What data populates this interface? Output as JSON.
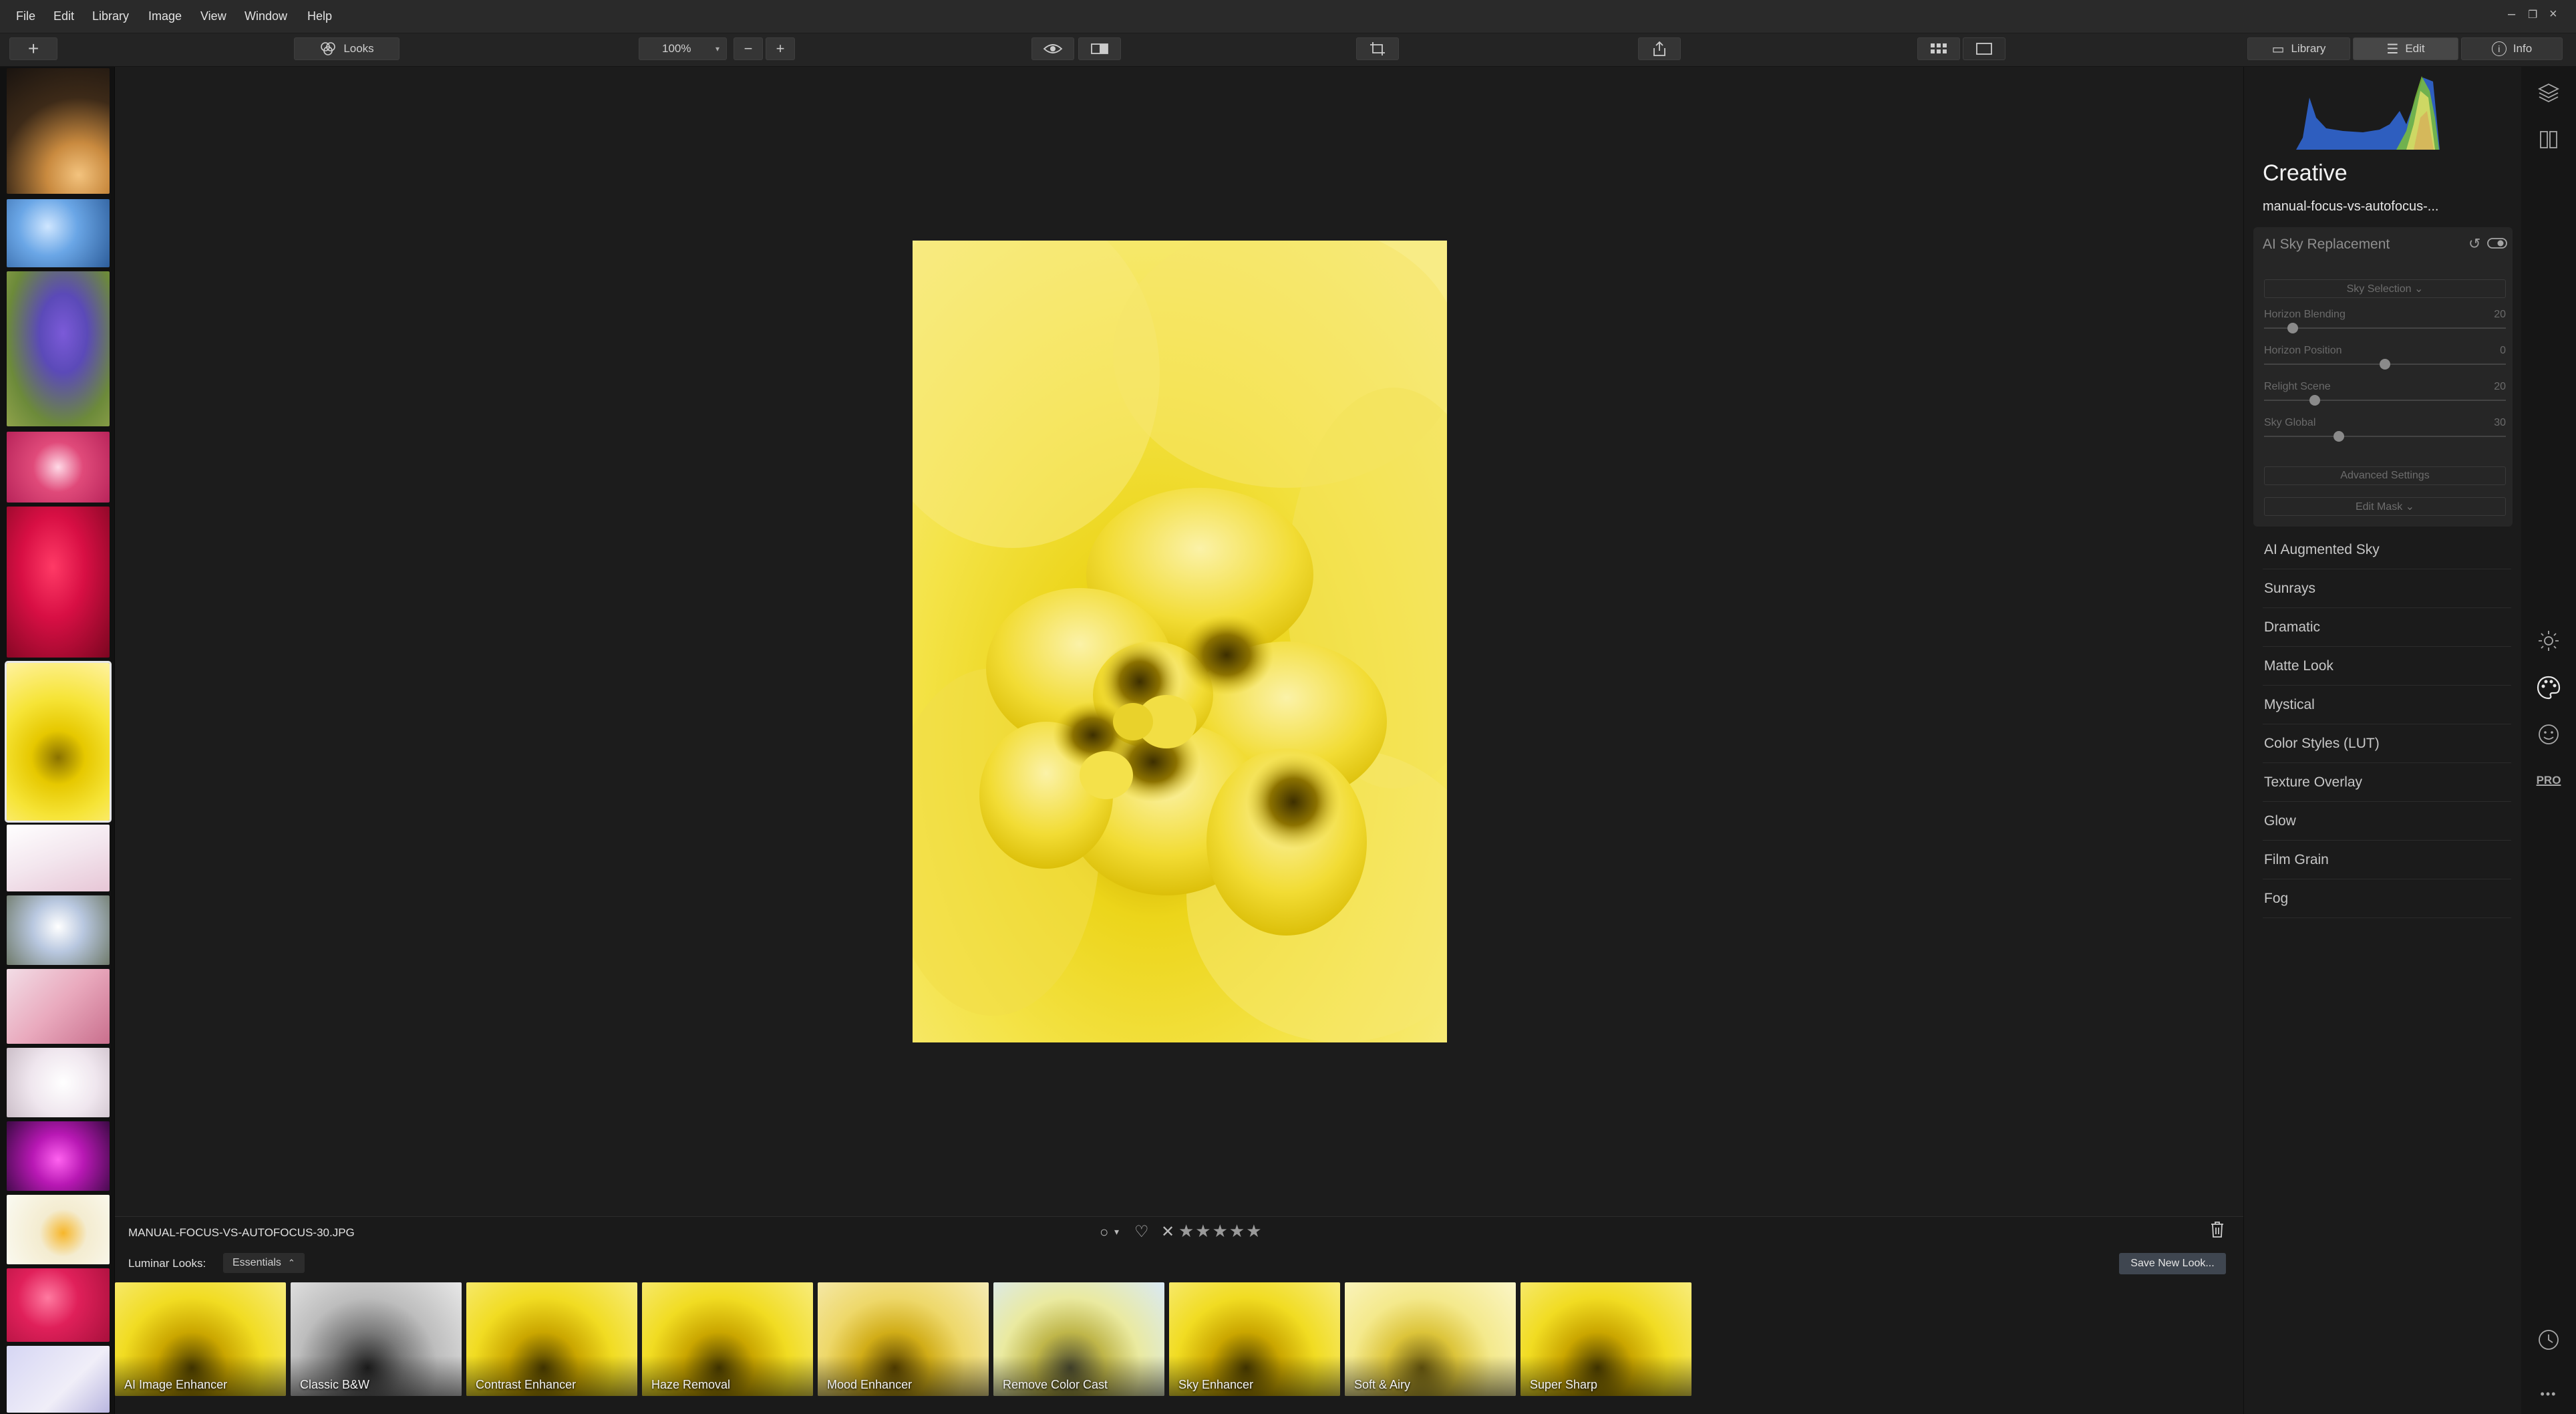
{
  "menu": [
    "File",
    "Edit",
    "Library",
    "Image",
    "View",
    "Window",
    "Help"
  ],
  "toolbar": {
    "looks_label": "Looks",
    "zoom_value": "100%",
    "modes": [
      {
        "label": "Library",
        "icon": "library-icon"
      },
      {
        "label": "Edit",
        "icon": "sliders-icon"
      },
      {
        "label": "Info",
        "icon": "info-icon"
      }
    ]
  },
  "panel": {
    "section_title": "Creative",
    "file_short_name": "manual-focus-vs-autofocus-...",
    "active_tool": {
      "title": "AI Sky Replacement",
      "sky_selection_label": "Sky Selection ⌄",
      "sliders": [
        {
          "label": "Horizon Blending",
          "value": 20,
          "fraction": 0.12
        },
        {
          "label": "Horizon Position",
          "value": 0,
          "fraction": 0.5
        },
        {
          "label": "Relight Scene",
          "value": 20,
          "fraction": 0.21
        },
        {
          "label": "Sky Global",
          "value": 30,
          "fraction": 0.31
        }
      ],
      "advanced_settings_label": "Advanced Settings",
      "edit_mask_label": "Edit Mask ⌄"
    },
    "tools": [
      "AI Augmented Sky",
      "Sunrays",
      "Dramatic",
      "Matte Look",
      "Mystical",
      "Color Styles (LUT)",
      "Texture Overlay",
      "Glow",
      "Film Grain",
      "Fog"
    ]
  },
  "rail_icons": [
    "layers-icon",
    "compare-icon",
    "sun-icon",
    "palette-icon",
    "face-icon",
    "pro-icon",
    "history-icon",
    "more-icon"
  ],
  "rail_pro_label": "PRO",
  "bottom": {
    "file_name": "MANUAL-FOCUS-VS-AUTOFOCUS-30.JPG",
    "looks_label": "Luminar Looks:",
    "looks_category": "Essentials",
    "save_look_label": "Save New Look...",
    "looks": [
      {
        "label": "AI Image Enhancer",
        "style": "color"
      },
      {
        "label": "Classic B&W",
        "style": "bw"
      },
      {
        "label": "Contrast Enhancer",
        "style": "color"
      },
      {
        "label": "Haze Removal",
        "style": "color"
      },
      {
        "label": "Mood Enhancer",
        "style": "warm"
      },
      {
        "label": "Remove Color Cast",
        "style": "cool"
      },
      {
        "label": "Sky Enhancer",
        "style": "color"
      },
      {
        "label": "Soft & Airy",
        "style": "soft"
      },
      {
        "label": "Super Sharp",
        "style": "color"
      }
    ]
  },
  "colors": {
    "accent_yellow": "#f4e12c",
    "histogram_blue": "#2f62c8",
    "histogram_green": "#7bbf3a"
  }
}
